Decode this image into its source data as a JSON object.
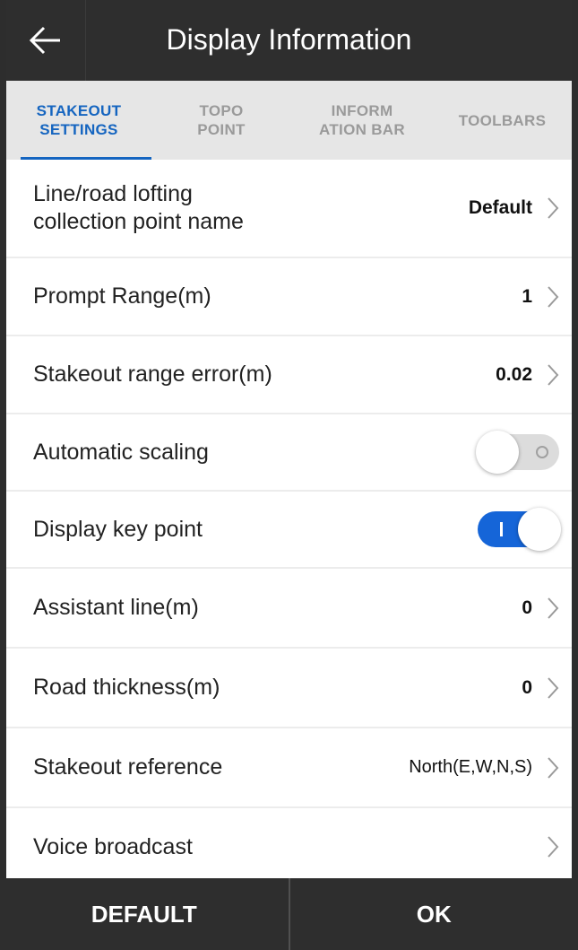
{
  "header": {
    "title": "Display Information",
    "back_icon": "arrow-left-icon"
  },
  "tabs": [
    {
      "label": "STAKEOUT\nSETTINGS",
      "active": true
    },
    {
      "label": "TOPO\nPOINT",
      "active": false
    },
    {
      "label": "INFORM\nATION BAR",
      "active": false
    },
    {
      "label": "TOOLBARS",
      "active": false
    }
  ],
  "settings": [
    {
      "label": "Line/road lofting collection point name",
      "value": "Default"
    },
    {
      "label": "Prompt Range(m)",
      "value": "1"
    },
    {
      "label": "Stakeout range error(m)",
      "value": "0.02"
    },
    {
      "label": "Automatic scaling",
      "toggle": false
    },
    {
      "label": "Display key point",
      "toggle": true
    },
    {
      "label": "Assistant line(m)",
      "value": "0"
    },
    {
      "label": "Road thickness(m)",
      "value": "0"
    },
    {
      "label": "Stakeout reference",
      "value": "North(E,W,N,S)"
    },
    {
      "label": "Voice broadcast",
      "value": ""
    }
  ],
  "footer": {
    "default_label": "DEFAULT",
    "ok_label": "OK"
  },
  "colors": {
    "header_bg": "#2e2e2e",
    "accent": "#1565c0",
    "toggle_on": "#1565d8"
  }
}
